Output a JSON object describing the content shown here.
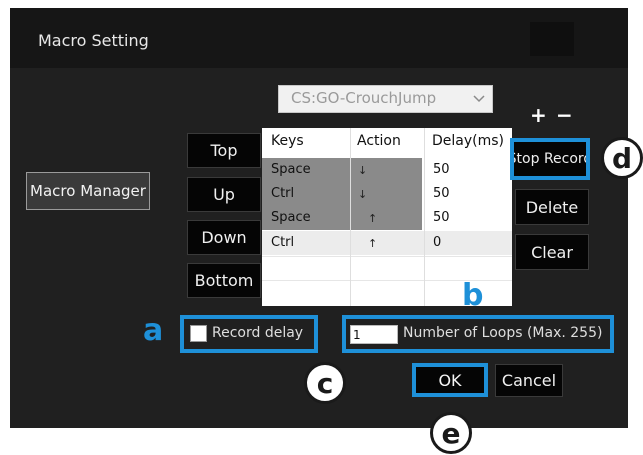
{
  "window": {
    "title": "Macro Setting"
  },
  "profile_dropdown": {
    "value": "CS:GO-CrouchJump"
  },
  "toolbar": {
    "plus": "+",
    "minus": "−"
  },
  "move_buttons": {
    "top": "Top",
    "up": "Up",
    "down": "Down",
    "bottom": "Bottom"
  },
  "macro_manager": {
    "label": "Macro Manager"
  },
  "table": {
    "headers": [
      "Keys",
      "Action",
      "Delay(ms)"
    ],
    "rows": [
      {
        "key": "Space",
        "action": "↓",
        "delay": "50"
      },
      {
        "key": "Ctrl",
        "action": "↓",
        "delay": "50"
      },
      {
        "key": "Space",
        "action": "↑",
        "delay": "50"
      },
      {
        "key": "Ctrl",
        "action": "↑",
        "delay": "0"
      }
    ]
  },
  "side_buttons": {
    "stop_record": "Stop Record",
    "delete": "Delete",
    "clear": "Clear"
  },
  "options": {
    "record_delay_label": "Record delay",
    "record_delay_checked": false,
    "loops_value": "1",
    "loops_label": "Number of Loops (Max. 255)"
  },
  "dialog_buttons": {
    "ok": "OK",
    "cancel": "Cancel"
  },
  "annotation_markers": {
    "a": "a",
    "b": "b",
    "c": "c",
    "d": "d",
    "e": "e"
  },
  "colors": {
    "callout_blue": "#1e90d8",
    "window_bg": "#202020",
    "selected_row": "#8a8a8a"
  }
}
